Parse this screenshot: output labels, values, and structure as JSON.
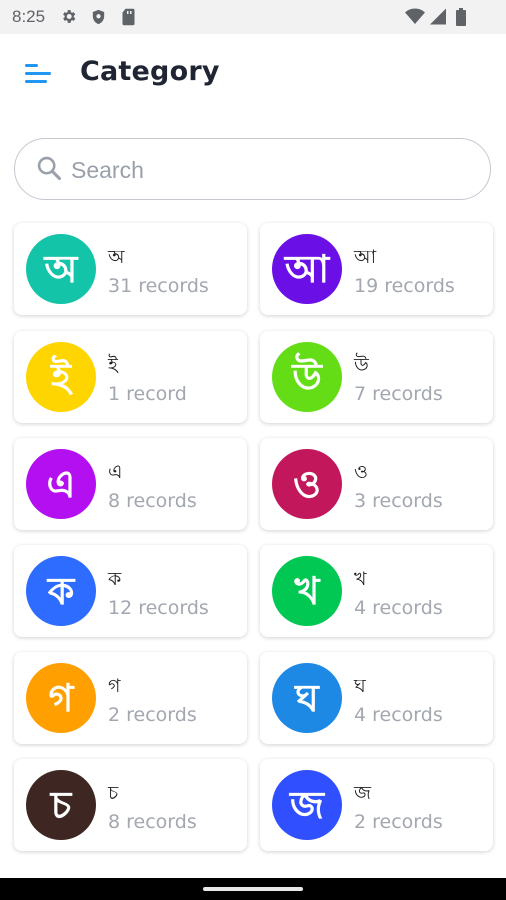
{
  "status_bar": {
    "time": "8:25",
    "icons": [
      "gear-icon",
      "shield-icon",
      "sd-card-icon",
      "wifi-icon",
      "signal-icon",
      "battery-icon"
    ]
  },
  "header": {
    "title": "Category",
    "menu_icon": "menu-icon",
    "accent_color": "#2196f3"
  },
  "search": {
    "placeholder": "Search",
    "value": ""
  },
  "categories": [
    {
      "letter": "অ",
      "name": "অ",
      "count": "31 records",
      "color": "#13c4a8"
    },
    {
      "letter": "আ",
      "name": "আ",
      "count": "19 records",
      "color": "#6a0fe6"
    },
    {
      "letter": "ই",
      "name": "ই",
      "count": "1 record",
      "color": "#ffd500"
    },
    {
      "letter": "উ",
      "name": "উ",
      "count": "7 records",
      "color": "#64dd17"
    },
    {
      "letter": "এ",
      "name": "এ",
      "count": "8 records",
      "color": "#b40ff0"
    },
    {
      "letter": "ও",
      "name": "ও",
      "count": "3 records",
      "color": "#c2185b"
    },
    {
      "letter": "ক",
      "name": "ক",
      "count": "12 records",
      "color": "#2e6bff"
    },
    {
      "letter": "খ",
      "name": "খ",
      "count": "4 records",
      "color": "#00c853"
    },
    {
      "letter": "গ",
      "name": "গ",
      "count": "2 records",
      "color": "#ffa000"
    },
    {
      "letter": "ঘ",
      "name": "ঘ",
      "count": "4 records",
      "color": "#1e88e5"
    },
    {
      "letter": "চ",
      "name": "চ",
      "count": "8 records",
      "color": "#3e2723"
    },
    {
      "letter": "জ",
      "name": "জ",
      "count": "2 records",
      "color": "#304ffe"
    }
  ]
}
